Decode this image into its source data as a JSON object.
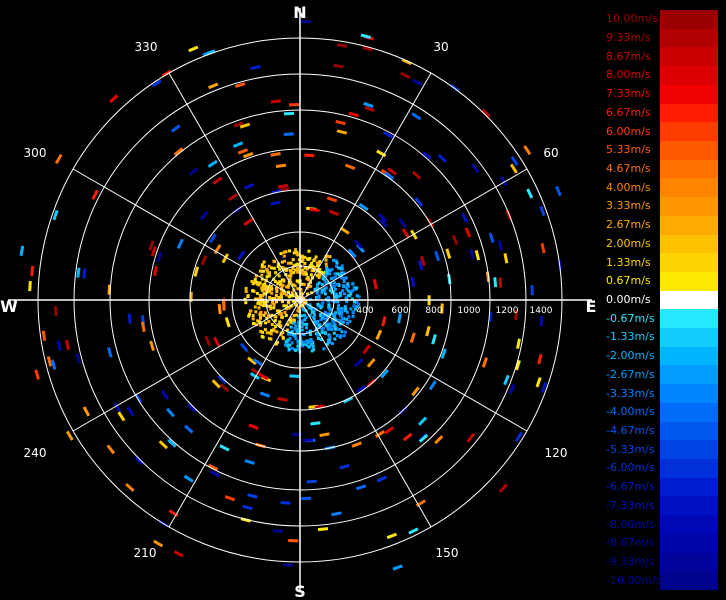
{
  "compass": {
    "north": "N",
    "east": "E",
    "south": "S",
    "west": "W"
  },
  "azimuth_labels": [
    "30",
    "60",
    "120",
    "150",
    "210",
    "240",
    "300",
    "330"
  ],
  "range_labels": [
    "400",
    "600",
    "800",
    "1000",
    "1200",
    "1400"
  ],
  "legend": {
    "labels": [
      "10.00m/s",
      "9.33m/s",
      "8.67m/s",
      "8.00m/s",
      "7.33m/s",
      "6.67m/s",
      "6.00m/s",
      "5.33m/s",
      "4.67m/s",
      "4.00m/s",
      "3.33m/s",
      "2.67m/s",
      "2.00m/s",
      "1.33m/s",
      "0.67m/s",
      "0.00m/s",
      "-0.67m/s",
      "-1.33m/s",
      "-2.00m/s",
      "-2.67m/s",
      "-3.33m/s",
      "-4.00m/s",
      "-4.67m/s",
      "-5.33m/s",
      "-6.00m/s",
      "-6.67m/s",
      "-7.33m/s",
      "-8.00m/s",
      "-8.67m/s",
      "-9.33m/s",
      "-10.00m/s"
    ],
    "colors": [
      "#9b0000",
      "#b00000",
      "#c80000",
      "#dc0000",
      "#f00000",
      "#ff1c00",
      "#ff3c00",
      "#ff5a00",
      "#ff7000",
      "#ff8400",
      "#ff9800",
      "#ffaa00",
      "#ffc000",
      "#ffd400",
      "#ffe800",
      "#ffffff",
      "#28e8ff",
      "#12ccff",
      "#00b4ff",
      "#009cff",
      "#0084ff",
      "#006cf8",
      "#0058ee",
      "#0044e4",
      "#0030da",
      "#001cd0",
      "#0010c4",
      "#0008b6",
      "#0004a8",
      "#00049a",
      "#00048c"
    ]
  },
  "colors": {
    "background": "#000000",
    "grid": "#ffffff"
  }
}
